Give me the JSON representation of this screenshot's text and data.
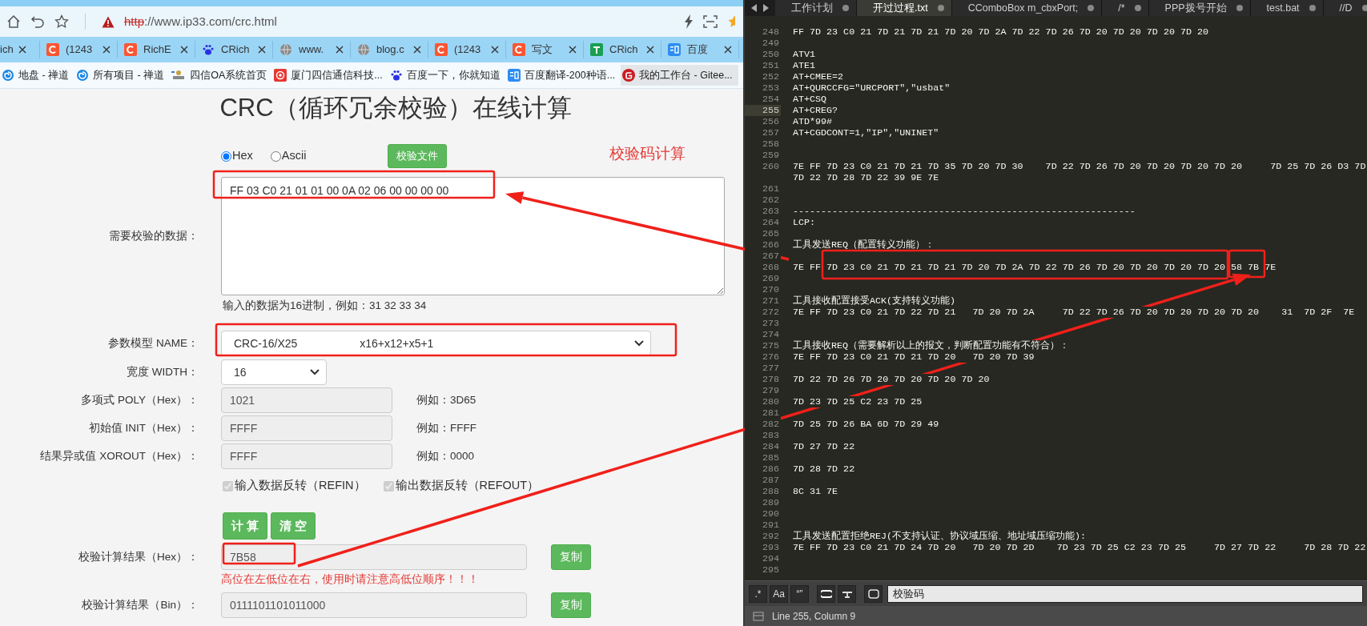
{
  "browser": {
    "url_scheme": "http",
    "url_rest": "://www.ip33.com/crc.html",
    "tabs": [
      {
        "label": "ich"
      },
      {
        "label": "(1243"
      },
      {
        "label": "RichE"
      },
      {
        "label": "CRich"
      },
      {
        "label": "www."
      },
      {
        "label": "blog.c"
      },
      {
        "label": "(1243"
      },
      {
        "label": "写文"
      },
      {
        "label": "CRich"
      },
      {
        "label": "百度"
      }
    ],
    "bookmarks": [
      {
        "label": "地盘 - 禅道",
        "selected": false
      },
      {
        "label": "所有项目 - 禅道",
        "selected": false
      },
      {
        "label": "四信OA系统首页",
        "selected": false
      },
      {
        "label": "厦门四信通信科技...",
        "selected": false
      },
      {
        "label": "百度一下，你就知道",
        "selected": false
      },
      {
        "label": "百度翻译-200种语...",
        "selected": false
      },
      {
        "label": "我的工作台 - Gitee...",
        "selected": true
      }
    ]
  },
  "page": {
    "title": "CRC（循环冗余校验）在线计算",
    "annotation": "校验码计算",
    "input_modes": [
      {
        "label": "Hex",
        "selected": true
      },
      {
        "label": "Ascii",
        "selected": false
      }
    ],
    "file_button": "校验文件",
    "data_label": "需要校验的数据：",
    "data_value": "FF 03 C0 21 01 01 00 0A 02 06 00 00 00 00",
    "data_hint": "输入的数据为16进制，例如：31 32 33 34",
    "model_label": "参数模型 NAME：",
    "model_value": "CRC-16/X25                    x16+x12+x5+1",
    "width_label": "宽度 WIDTH：",
    "width_value": "16",
    "params": [
      {
        "label": "多项式 POLY（Hex）：",
        "value": "1021",
        "example": "例如：3D65"
      },
      {
        "label": "初始值 INIT（Hex）：",
        "value": "FFFF",
        "example": "例如：FFFF"
      },
      {
        "label": "结果异或值 XOROUT（Hex）：",
        "value": "FFFF",
        "example": "例如：0000"
      }
    ],
    "options": [
      {
        "label": "输入数据反转（REFIN）",
        "checked": true,
        "disabled": true
      },
      {
        "label": "输出数据反转（REFOUT）",
        "checked": true,
        "disabled": true
      }
    ],
    "actions": [
      "计 算",
      "清 空"
    ],
    "results": [
      {
        "label": "校验计算结果（Hex）：",
        "value": "7B58",
        "button": "复制",
        "note": "高位在左低位在右，使用时请注意高低位顺序！！！"
      },
      {
        "label": "校验计算结果（Bin）：",
        "value": "0111101101011000",
        "button": "复制"
      }
    ]
  },
  "editor": {
    "tabs": [
      {
        "label": "工作计划",
        "selected": false
      },
      {
        "label": "开过过程.txt",
        "selected": true
      },
      {
        "label": "CComboBox m_cbxPort;",
        "selected": false
      },
      {
        "label": "/*",
        "selected": false
      },
      {
        "label": "PPP拨号开始",
        "selected": false
      },
      {
        "label": "test.bat",
        "selected": false
      },
      {
        "label": "//D",
        "selected": false
      }
    ],
    "lines": [
      {
        "number": "248",
        "text": "FF 7D 23 C0 21 7D 21 7D 21 7D 20 7D 2A 7D 22 7D 26 7D 20 7D 20 7D 20 7D 20",
        "current": false
      },
      {
        "number": "249",
        "current": false
      },
      {
        "number": "250",
        "text": "ATV1",
        "current": false
      },
      {
        "number": "251",
        "text": "ATE1",
        "current": false
      },
      {
        "number": "252",
        "text": "AT+CMEE=2",
        "current": false
      },
      {
        "number": "253",
        "text": "AT+QURCCFG=\"URCPORT\",\"usbat\"",
        "current": false
      },
      {
        "number": "254",
        "text": "AT+CSQ",
        "current": false
      },
      {
        "number": "255",
        "text": "AT+CREG?",
        "current": true
      },
      {
        "number": "256",
        "text": "ATD*99#",
        "current": false
      },
      {
        "number": "257",
        "text": "AT+CGDCONT=1,\"IP\",\"UNINET\"",
        "current": false
      },
      {
        "number": "258",
        "current": false
      },
      {
        "number": "259",
        "current": false
      },
      {
        "number": "260",
        "text": "7E FF 7D 23 C0 21 7D 21 7D 35 7D 20 7D 30    7D 22 7D 26 7D 20 7D 20 7D 20 7D 20     7D 25 7D 26 D3 7D",
        "wrapped": "7D 22 7D 28 7D 22 39 9E 7E",
        "current": false
      },
      {
        "number": "261",
        "current": false
      },
      {
        "number": "262",
        "current": false
      },
      {
        "number": "263",
        "text": "-------------------------------------------------------------",
        "current": false
      },
      {
        "number": "264",
        "text": "LCP:",
        "current": false
      },
      {
        "number": "265",
        "current": false
      },
      {
        "number": "266",
        "text": "工具发送REQ（配置转义功能）：",
        "current": false
      },
      {
        "number": "267",
        "current": false
      },
      {
        "number": "268",
        "text": "7E FF 7D 23 C0 21 7D 21 7D 21 7D 20 7D 2A 7D 22 7D 26 7D 20 7D 20 7D 20 7D 20 58 7B 7E",
        "current": false
      },
      {
        "number": "269",
        "current": false
      },
      {
        "number": "270",
        "current": false
      },
      {
        "number": "271",
        "text": "工具接收配置接受ACK(支持转义功能)",
        "current": false
      },
      {
        "number": "272",
        "text": "7E FF 7D 23 C0 21 7D 22 7D 21   7D 20 7D 2A     7D 22 7D 26 7D 20 7D 20 7D 20 7D 20    31  7D 2F  7E",
        "current": false
      },
      {
        "number": "273",
        "current": false
      },
      {
        "number": "274",
        "current": false
      },
      {
        "number": "275",
        "text": "工具接收REQ（需要解析以上的报文，判断配置功能有不符合）：",
        "current": false
      },
      {
        "number": "276",
        "text": "7E FF 7D 23 C0 21 7D 21 7D 20   7D 20 7D 39",
        "current": false
      },
      {
        "number": "277",
        "current": false
      },
      {
        "number": "278",
        "text": "7D 22 7D 26 7D 20 7D 20 7D 20 7D 20",
        "current": false
      },
      {
        "number": "279",
        "current": false
      },
      {
        "number": "280",
        "text": "7D 23 7D 25 C2 23 7D 25",
        "current": false
      },
      {
        "number": "281",
        "current": false
      },
      {
        "number": "282",
        "text": "7D 25 7D 26 BA 6D 7D 29 49",
        "current": false
      },
      {
        "number": "283",
        "current": false
      },
      {
        "number": "284",
        "text": "7D 27 7D 22",
        "current": false
      },
      {
        "number": "285",
        "current": false
      },
      {
        "number": "286",
        "text": "7D 28 7D 22",
        "current": false
      },
      {
        "number": "287",
        "current": false
      },
      {
        "number": "288",
        "text": "8C 31 7E",
        "current": false
      },
      {
        "number": "289",
        "current": false
      },
      {
        "number": "290",
        "current": false
      },
      {
        "number": "291",
        "current": false
      },
      {
        "number": "292",
        "text": "工具发送配置拒绝REJ(不支持认证、协议域压缩、地址域压缩功能):",
        "current": false
      },
      {
        "number": "293",
        "text": "7E FF 7D 23 C0 21 7D 24 7D 20   7D 20 7D 2D    7D 23 7D 25 C2 23 7D 25     7D 27 7D 22     7D 28 7D 22",
        "current": false
      },
      {
        "number": "294",
        "current": false
      },
      {
        "number": "295",
        "current": false
      }
    ],
    "find": {
      "toggles": [
        ".*",
        "Aa",
        "“”"
      ],
      "value": "校验码"
    },
    "status": "Line 255, Column 9"
  }
}
